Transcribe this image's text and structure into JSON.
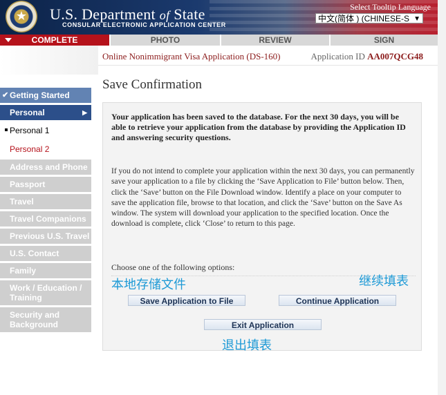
{
  "header": {
    "title_main": "U.S. Department",
    "title_of": "of",
    "title_state": "State",
    "subtitle": "CONSULAR ELECTRONIC APPLICATION CENTER",
    "seal_icon": "state-department-seal",
    "tooltip_language_label": "Select Tooltip Language",
    "tooltip_language_value": "中文(简体 ) (CHINESE-S"
  },
  "progress": {
    "steps": [
      {
        "label": "COMPLETE",
        "active": true
      },
      {
        "label": "PHOTO",
        "active": false
      },
      {
        "label": "REVIEW",
        "active": false
      },
      {
        "label": "SIGN",
        "active": false
      }
    ]
  },
  "application": {
    "form_title": "Online Nonimmigrant Visa Application (DS-160)",
    "id_label": "Application ID",
    "id_value": "AA007QCG48"
  },
  "sidebar": {
    "getting_started": "Getting Started",
    "personal": "Personal",
    "personal_1": "Personal 1",
    "personal_2": "Personal 2",
    "items": [
      "Address and Phone",
      "Passport",
      "Travel",
      "Travel Companions",
      "Previous U.S. Travel",
      "U.S. Contact",
      "Family",
      "Work / Education / Training",
      "Security and Background"
    ]
  },
  "main": {
    "page_title": "Save Confirmation",
    "saved_message": "Your application has been saved to the database. For the next 30 days, you will be able to retrieve your application from the database by providing the Application ID and answering security questions.",
    "instructions": "If you do not intend to complete your application within the next 30 days, you can permanently save your application to a file by clicking the ‘Save Application to File’ button below. Then, click the ‘Save’ button on the File Download window. Identify a place on your computer to save the application file, browse to that location, and click the ‘Save’ button on the Save As window. The system will download your application to the specified location. Once the download is complete, click ‘Close’ to return to this page.",
    "choose_options": "Choose one of the following options:",
    "save_to_file_label": "Save Application to File",
    "continue_label": "Continue Application",
    "exit_label": "Exit Application"
  },
  "annotations": {
    "save_local": "本地存储文件",
    "continue_fill": "继续填表",
    "exit_fill": "退出填表",
    "color": "#1e9ad6"
  },
  "colors": {
    "accent_red": "#b5121b",
    "nav_blue": "#2c4f8a",
    "nav_light_blue": "#6283b3",
    "disabled_gray": "#cfcfcf"
  }
}
